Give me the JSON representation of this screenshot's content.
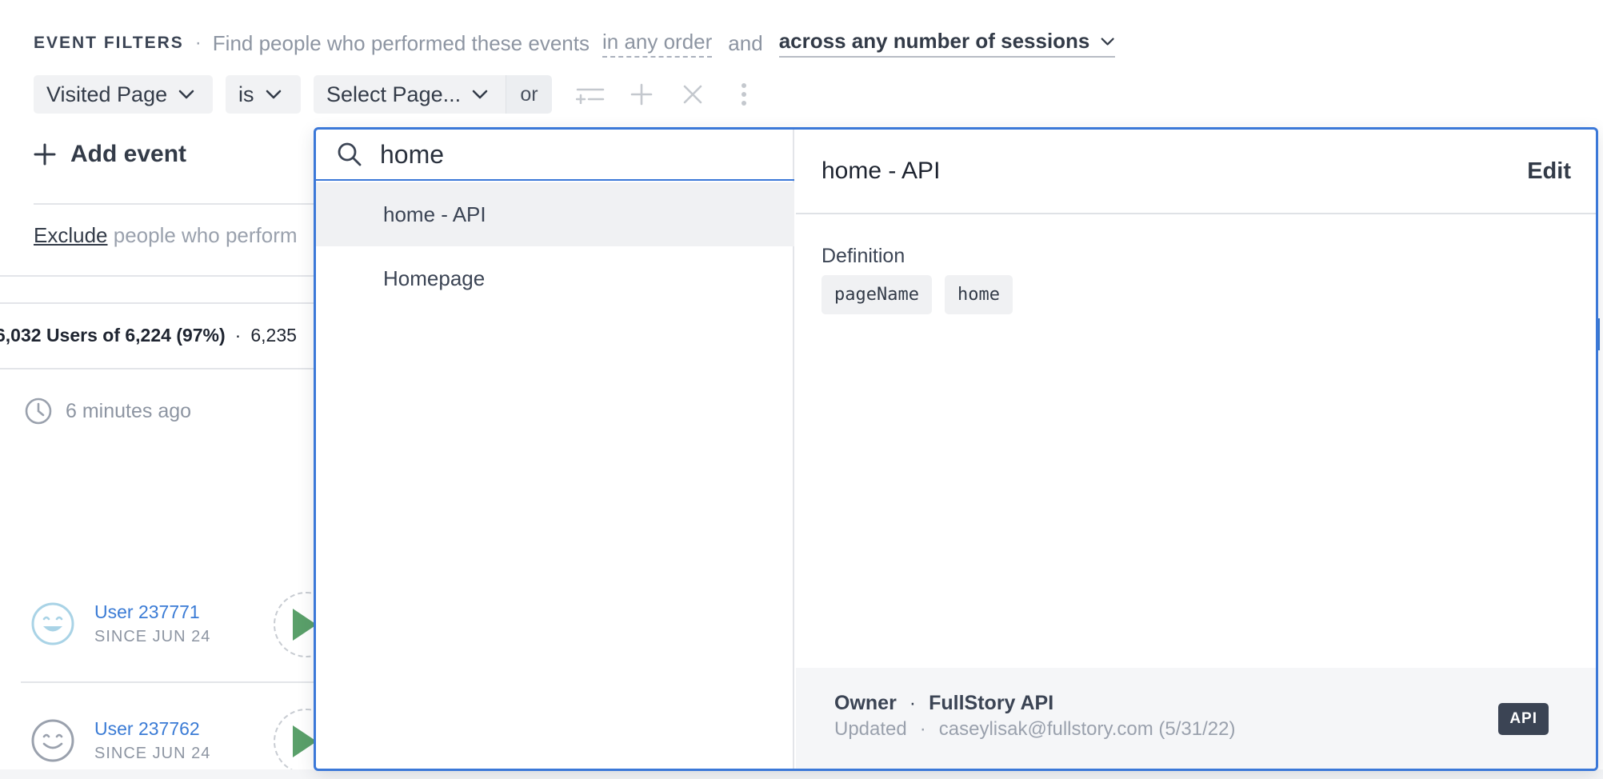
{
  "filters": {
    "label": "EVENT FILTERS",
    "separator": "·",
    "description": "Find people who performed these events",
    "order": "in any order",
    "conjunction": "and",
    "sessions": "across any number of sessions"
  },
  "condition": {
    "event": "Visited Page",
    "operator": "is",
    "value_placeholder": "Select Page...",
    "or_label": "or"
  },
  "actions": {
    "add_event": "Add event"
  },
  "exclude": {
    "link": "Exclude",
    "text": "people who perform"
  },
  "summary": {
    "users": "6,032 Users of 6,224 (97%)",
    "separator": "·",
    "second": "6,235"
  },
  "activity": {
    "time": "6 minutes ago"
  },
  "users": [
    {
      "name": "User 237771",
      "since": "SINCE JUN 24",
      "face_color": "#a9d3e6"
    },
    {
      "name": "User 237762",
      "since": "SINCE JUN 24",
      "face_color": "#9aa1ad"
    }
  ],
  "dropdown": {
    "search_value": "home",
    "options": [
      {
        "label": "home - API",
        "selected": true
      },
      {
        "label": "Homepage",
        "selected": false
      }
    ],
    "detail": {
      "title": "home - API",
      "edit_label": "Edit",
      "definition_label": "Definition",
      "definition_chips": [
        "pageName",
        "home"
      ],
      "owner_label": "Owner",
      "owner_sep": "·",
      "owner_name": "FullStory API",
      "updated_label": "Updated",
      "updated_sep": "·",
      "updated_value": "caseylisak@fullstory.com (5/31/22)",
      "badge": "API"
    }
  },
  "colors": {
    "accent": "#3b78d8",
    "link": "#3a7bd5",
    "play": "#5aa06a",
    "text": "#3b4454"
  }
}
